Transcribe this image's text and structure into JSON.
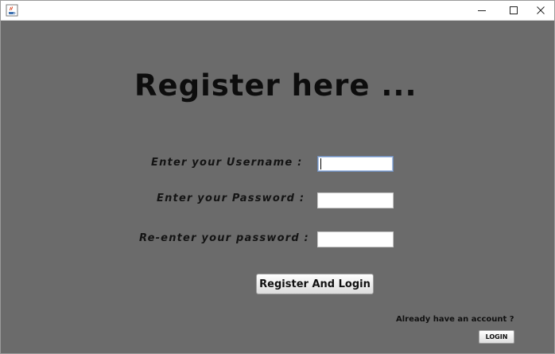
{
  "window": {
    "icon": "java-cup-icon",
    "controls": {
      "minimize": "minimize-icon",
      "maximize": "maximize-icon",
      "close": "close-icon"
    }
  },
  "form": {
    "heading": "Register here ...",
    "username_label": "Enter your Username :",
    "password_label": "Enter your Password :",
    "repassword_label": "Re-enter your password :",
    "username_value": "",
    "password_value": "",
    "repassword_value": "",
    "register_button": "Register And Login",
    "account_prompt": "Already have an account ?",
    "login_button": "LOGIN"
  },
  "colors": {
    "background": "#6b6b6b",
    "text": "#0d0d0d",
    "field_focus_border": "#6f8cb8"
  }
}
